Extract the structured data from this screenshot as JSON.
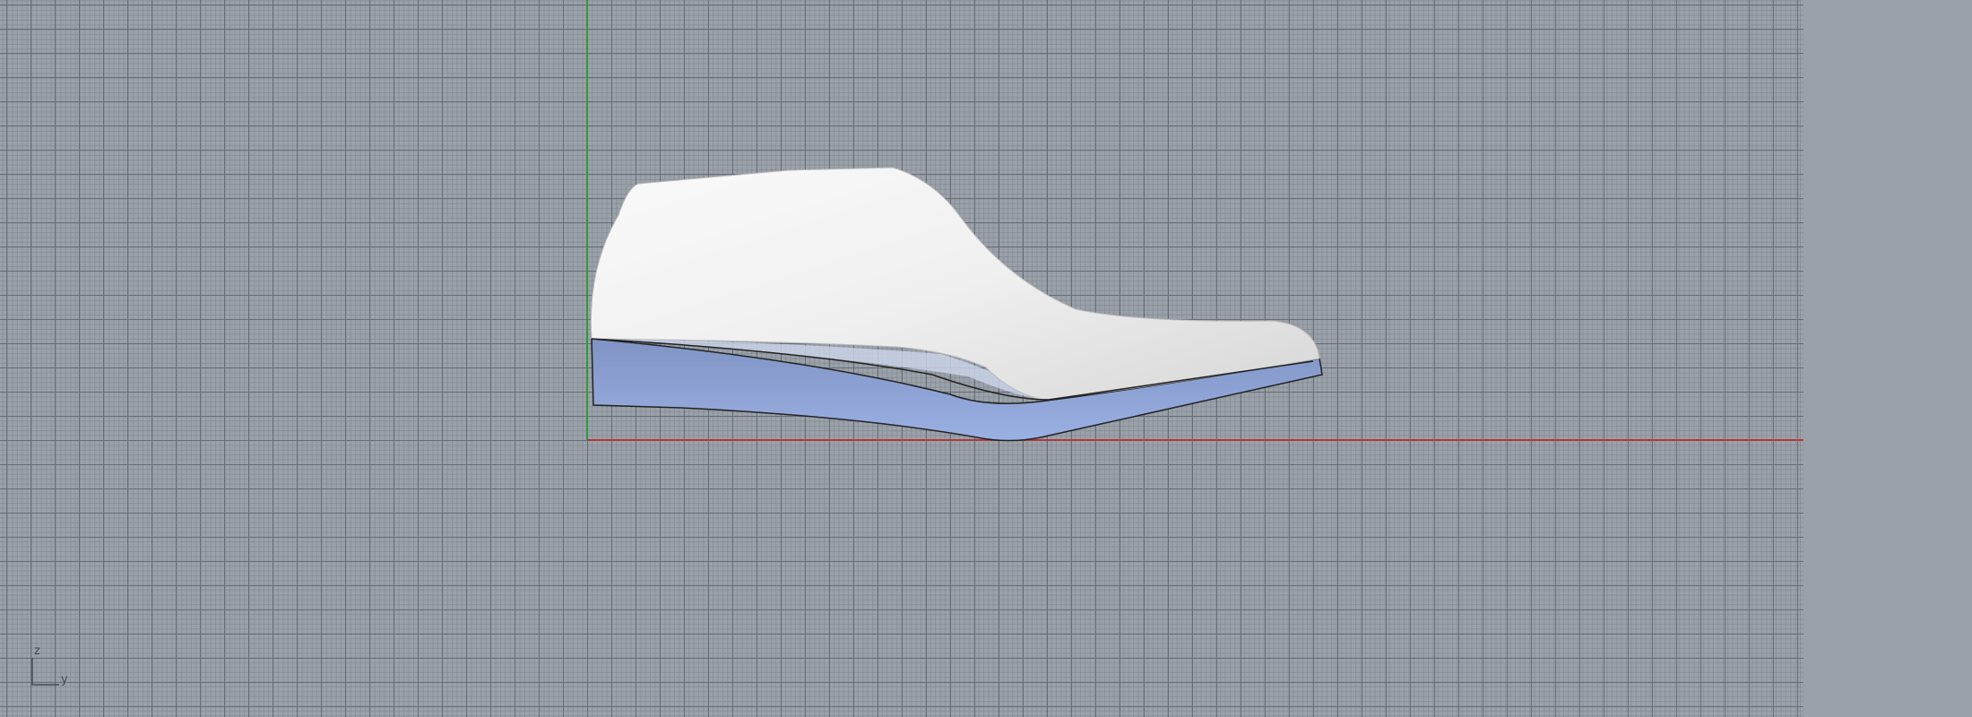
{
  "viewport": {
    "axis_indicator": {
      "z_label": "z",
      "y_label": "y"
    },
    "colors": {
      "background": "#9ba1a9",
      "x_axis": "#b03a3a",
      "y_axis": "#2e9a3a",
      "sole": "#93a8dc",
      "upper": "#f2f2f2"
    }
  }
}
